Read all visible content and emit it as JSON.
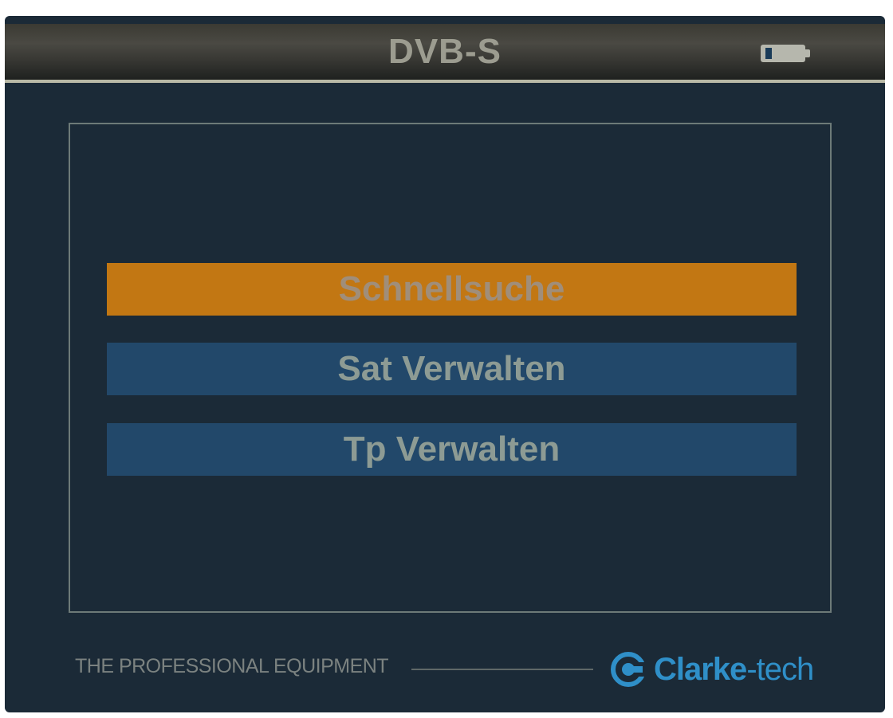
{
  "header": {
    "title": "DVB-S",
    "battery_icon": "battery-icon"
  },
  "menu": {
    "items": [
      {
        "label": "Schnellsuche",
        "selected": true
      },
      {
        "label": "Sat Verwalten",
        "selected": false
      },
      {
        "label": "Tp Verwalten",
        "selected": false
      }
    ]
  },
  "footer": {
    "tagline": "THE PROFESSIONAL EQUIPMENT",
    "brand_name": "Clarke",
    "brand_suffix": "-tech",
    "brand_icon": "clarke-tech-logo-icon"
  },
  "colors": {
    "selected_item": "#c27713",
    "menu_item": "#22486a",
    "background": "#1b2a37",
    "brand": "#2f8fc8"
  }
}
